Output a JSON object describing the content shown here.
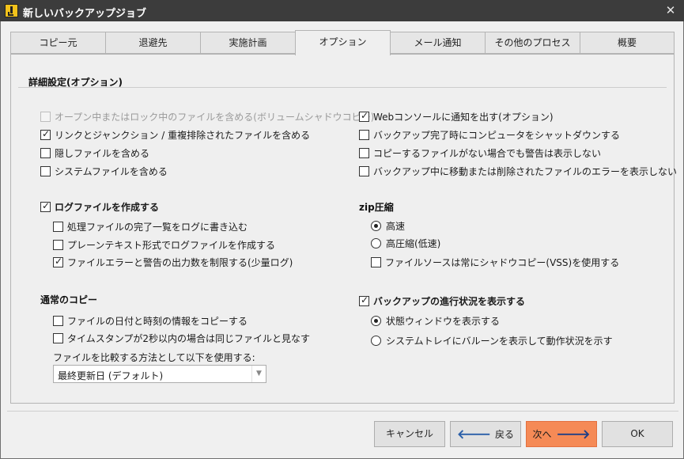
{
  "window": {
    "title": "新しいバックアップジョブ",
    "close_glyph": "✕"
  },
  "tabs": [
    "コピー元",
    "退避先",
    "実施計画",
    "オプション",
    "メール通知",
    "その他のプロセス",
    "概要"
  ],
  "active_tab": "オプション",
  "advanced": {
    "title": "詳細設定(オプション)",
    "left_options": [
      {
        "label": "オープン中またはロック中のファイルを含める(ボリュームシャドウコピー)",
        "checked": false,
        "disabled": true
      },
      {
        "label": "リンクとジャンクション / 重複排除されたファイルを含める",
        "checked": true
      },
      {
        "label": "隠しファイルを含める",
        "checked": false
      },
      {
        "label": "システムファイルを含める",
        "checked": false
      }
    ],
    "right_options": [
      {
        "label": "Webコンソールに通知を出す(オプション)",
        "checked": true
      },
      {
        "label": "バックアップ完了時にコンピュータをシャットダウンする",
        "checked": false
      },
      {
        "label": "コピーするファイルがない場合でも警告は表示しない",
        "checked": false
      },
      {
        "label": "バックアップ中に移動または削除されたファイルのエラーを表示しない",
        "checked": false
      }
    ]
  },
  "logging": {
    "title": "ログファイルを作成する",
    "checked": true,
    "options": [
      {
        "label": "処理ファイルの完了一覧をログに書き込む",
        "checked": false
      },
      {
        "label": "プレーンテキスト形式でログファイルを作成する",
        "checked": false
      },
      {
        "label": "ファイルエラーと警告の出力数を制限する(少量ログ)",
        "checked": true
      }
    ]
  },
  "zip": {
    "title": "zip圧縮",
    "radios": [
      {
        "label": "高速",
        "selected": true
      },
      {
        "label": "高圧縮(低速)",
        "selected": false
      }
    ],
    "vss_label": "ファイルソースは常にシャドウコピー(VSS)を使用する",
    "vss_checked": false
  },
  "normal_copy": {
    "title": "通常のコピー",
    "options": [
      {
        "label": "ファイルの日付と時刻の情報をコピーする",
        "checked": false
      },
      {
        "label": "タイムスタンプが2秒以内の場合は同じファイルと見なす",
        "checked": false
      }
    ],
    "compare_label": "ファイルを比較する方法として以下を使用する:",
    "compare_value": "最終更新日 (デフォルト)"
  },
  "progress": {
    "title": "バックアップの進行状況を表示する",
    "checked": true,
    "radios": [
      {
        "label": "状態ウィンドウを表示する",
        "selected": true
      },
      {
        "label": "システムトレイにバルーンを表示して動作状況を示す",
        "selected": false
      }
    ]
  },
  "buttons": {
    "cancel": "キャンセル",
    "back": "戻る",
    "next": "次へ",
    "ok": "OK"
  },
  "colors": {
    "primary_button": "#f58a56",
    "titlebar": "#3c3c3c"
  }
}
